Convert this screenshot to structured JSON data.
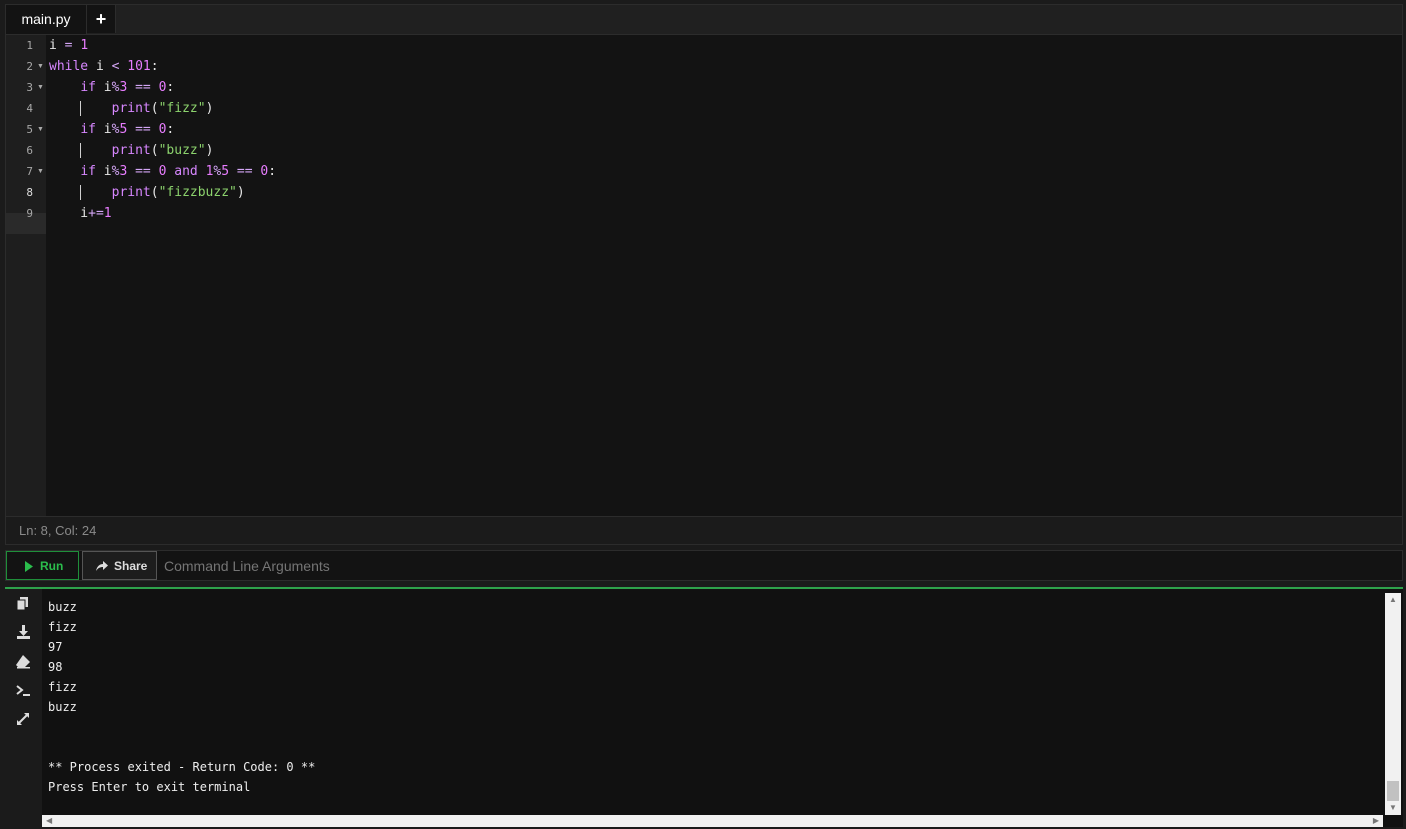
{
  "tabs": [
    {
      "label": "main.py"
    }
  ],
  "add_tab_label": "+",
  "editor": {
    "line_numbers": [
      "1",
      "2",
      "3",
      "4",
      "5",
      "6",
      "7",
      "8",
      "9"
    ],
    "lines": [
      "i = 1",
      "while i < 101:",
      "    if i%3 == 0:",
      "        print(\"fizz\")",
      "    if i%5 == 0:",
      "        print(\"buzz\")",
      "    if i%3 == 0 and 1%5 == 0:",
      "        print(\"fizzbuzz\")",
      "    i+=1"
    ],
    "status": "Ln: 8,  Col: 24"
  },
  "toolbar": {
    "run_label": "Run",
    "share_label": "Share",
    "args_placeholder": "Command Line Arguments"
  },
  "terminal": {
    "lines": [
      "buzz",
      "fizz",
      "97",
      "98",
      "fizz",
      "buzz",
      "",
      "",
      "** Process exited - Return Code: 0 **",
      "Press Enter to exit terminal"
    ]
  },
  "colors": {
    "accent_green": "#2bbd4c",
    "background": "#131313"
  }
}
